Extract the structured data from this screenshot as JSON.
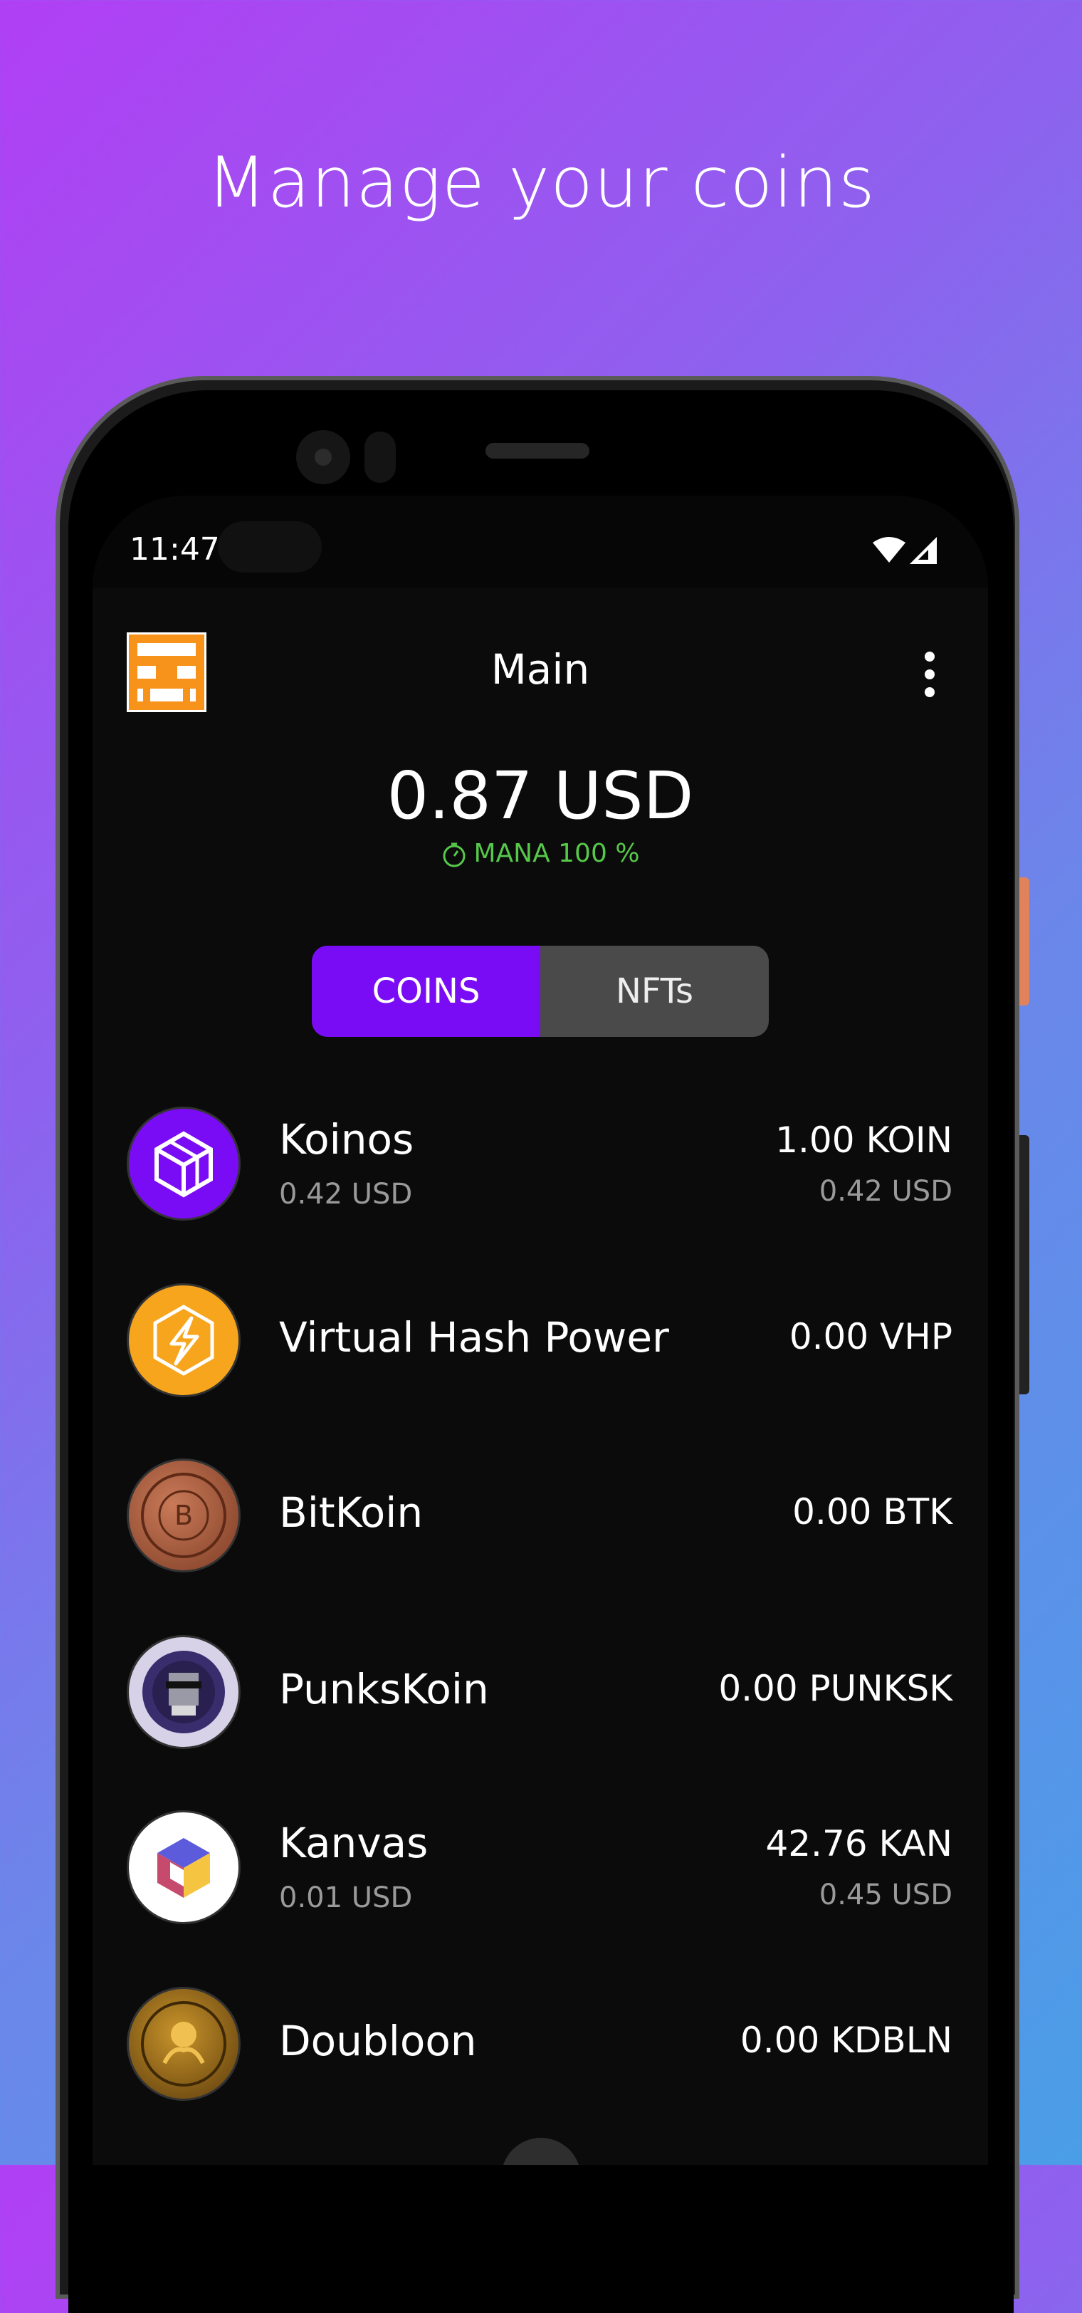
{
  "headline": "Manage your coins",
  "status": {
    "time": "11:47"
  },
  "header": {
    "title": "Main"
  },
  "balance": {
    "total": "0.87 USD",
    "mana_label": "MANA",
    "mana_value": "100 %"
  },
  "tabs": [
    {
      "label": "COINS",
      "active": true
    },
    {
      "label": "NFTs",
      "active": false
    }
  ],
  "coins": [
    {
      "name": "Koinos",
      "sub": "0.42 USD",
      "amount": "1.00 KOIN",
      "value": "0.42 USD",
      "icon": "koinos-cube-icon"
    },
    {
      "name": "Virtual Hash Power",
      "sub": "",
      "amount": "0.00 VHP",
      "value": "",
      "icon": "lightning-icon"
    },
    {
      "name": "BitKoin",
      "sub": "",
      "amount": "0.00 BTK",
      "value": "",
      "icon": "bronze-coin-icon"
    },
    {
      "name": "PunksKoin",
      "sub": "",
      "amount": "0.00 PUNKSK",
      "value": "",
      "icon": "punk-badge-icon"
    },
    {
      "name": "Kanvas",
      "sub": "0.01 USD",
      "amount": "42.76 KAN",
      "value": "0.45 USD",
      "icon": "kanvas-cube-icon"
    },
    {
      "name": "Doubloon",
      "sub": "",
      "amount": "0.00 KDBLN",
      "value": "",
      "icon": "doubloon-coin-icon"
    }
  ],
  "colors": {
    "accent": "#7a0cf5",
    "mana": "#56c84a",
    "background": "#0b0b0b"
  }
}
